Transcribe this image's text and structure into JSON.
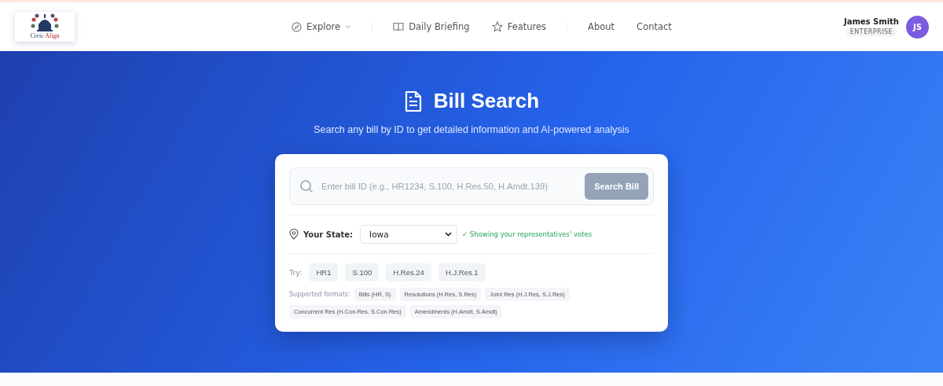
{
  "logo": {
    "first": "Civic",
    "second": "Align"
  },
  "nav": [
    {
      "label": "Explore",
      "kind": "dropdown"
    },
    {
      "label": "Daily Briefing",
      "kind": "link"
    },
    {
      "label": "Features",
      "kind": "link"
    },
    {
      "label": "About",
      "kind": "plain"
    },
    {
      "label": "Contact",
      "kind": "plain"
    }
  ],
  "user": {
    "name": "James Smith",
    "plan": "ENTERPRISE",
    "initials": "JS"
  },
  "hero": {
    "title": "Bill Search",
    "subtitle": "Search any bill by ID to get detailed information and AI-powered analysis"
  },
  "search": {
    "placeholder": "Enter bill ID (e.g., HR1234, S.100, H.Res.50, H.Amdt.139)",
    "button": "Search Bill",
    "disabled": true
  },
  "state": {
    "label": "Your State:",
    "value": "Iowa",
    "note": "✓ Showing your representatives' votes"
  },
  "try": {
    "label": "Try:",
    "examples": [
      "HR1",
      "S.100",
      "H.Res.24",
      "H.J.Res.1"
    ]
  },
  "formats": {
    "label": "Supported formats:",
    "items": [
      "Bills (HR, S)",
      "Resolutions (H.Res, S.Res)",
      "Joint Res (H.J.Res, S.J.Res)",
      "Concurrent Res (H.Con.Res, S.Con.Res)",
      "Amendments (H.Amdt, S.Amdt)"
    ]
  }
}
